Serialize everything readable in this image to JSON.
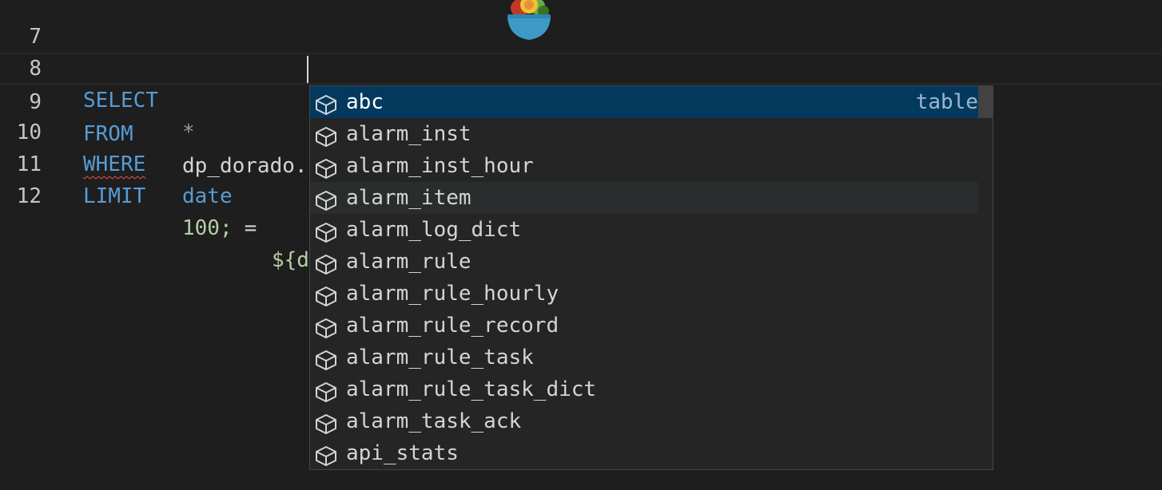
{
  "editor": {
    "lines": [
      {
        "number": "7"
      },
      {
        "number": "8",
        "keyword": "SELECT",
        "rest": "*"
      },
      {
        "number": "9",
        "keyword": "FROM",
        "rest": "dp_dorado."
      },
      {
        "number": "10",
        "keyword": "WHERE",
        "col": "date",
        "op": " = ",
        "rest": "${d"
      },
      {
        "number": "11",
        "keyword": "LIMIT",
        "rest": "100;"
      },
      {
        "number": "12"
      }
    ]
  },
  "suggest": {
    "items": [
      {
        "label": "abc",
        "detail": "table",
        "icon": "table-cube-icon"
      },
      {
        "label": "alarm_inst",
        "icon": "table-cube-icon"
      },
      {
        "label": "alarm_inst_hour",
        "icon": "table-cube-icon"
      },
      {
        "label": "alarm_item",
        "icon": "table-cube-icon"
      },
      {
        "label": "alarm_log_dict",
        "icon": "table-cube-icon"
      },
      {
        "label": "alarm_rule",
        "icon": "table-cube-icon"
      },
      {
        "label": "alarm_rule_hourly",
        "icon": "table-cube-icon"
      },
      {
        "label": "alarm_rule_record",
        "icon": "table-cube-icon"
      },
      {
        "label": "alarm_rule_task",
        "icon": "table-cube-icon"
      },
      {
        "label": "alarm_rule_task_dict",
        "icon": "table-cube-icon"
      },
      {
        "label": "alarm_task_ack",
        "icon": "table-cube-icon"
      },
      {
        "label": "api_stats",
        "icon": "table-cube-icon"
      }
    ]
  },
  "colors": {
    "keyword": "#569cd6",
    "number": "#b5cea8",
    "selected_bg": "#04395e",
    "hover_bg": "#2a2d2e",
    "widget_bg": "#252526"
  }
}
